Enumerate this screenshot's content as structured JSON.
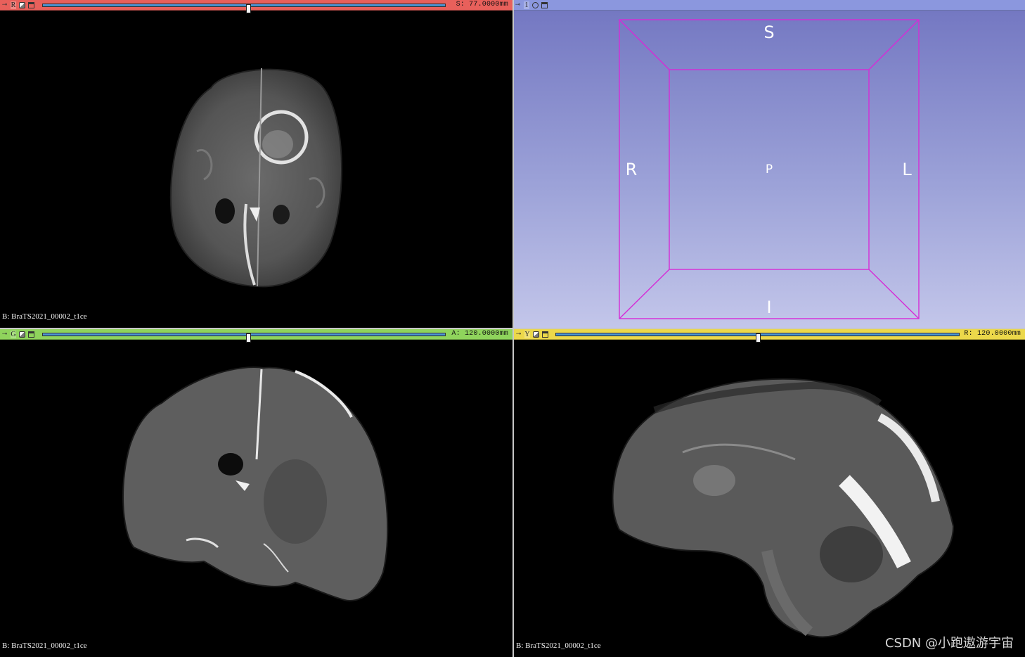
{
  "views": {
    "red": {
      "letter": "R",
      "offset_text": "S: 77.0000mm",
      "slider_fraction": 0.51,
      "volume_label": "B: BraTS2021_00002_t1ce",
      "color": "#e8605b"
    },
    "threed": {
      "letter": "1",
      "color": "#8b97de",
      "orientation": {
        "top": "S",
        "bottom": "I",
        "left": "R",
        "right": "L",
        "center": "P"
      }
    },
    "green": {
      "letter": "G",
      "offset_text": "A: 120.0000mm",
      "slider_fraction": 0.51,
      "volume_label": "B: BraTS2021_00002_t1ce",
      "color": "#8fd45c"
    },
    "yellow": {
      "letter": "Y",
      "offset_text": "R: 120.0000mm",
      "slider_fraction": 0.5,
      "volume_label": "B: BraTS2021_00002_t1ce",
      "color": "#ecd84a"
    }
  },
  "icons": {
    "pin": "pushpin-icon",
    "link": "link-icon",
    "maximize": "view-maximize-icon",
    "crosshair": "crosshair-icon"
  },
  "watermark": "CSDN @小跑遨游宇宙"
}
